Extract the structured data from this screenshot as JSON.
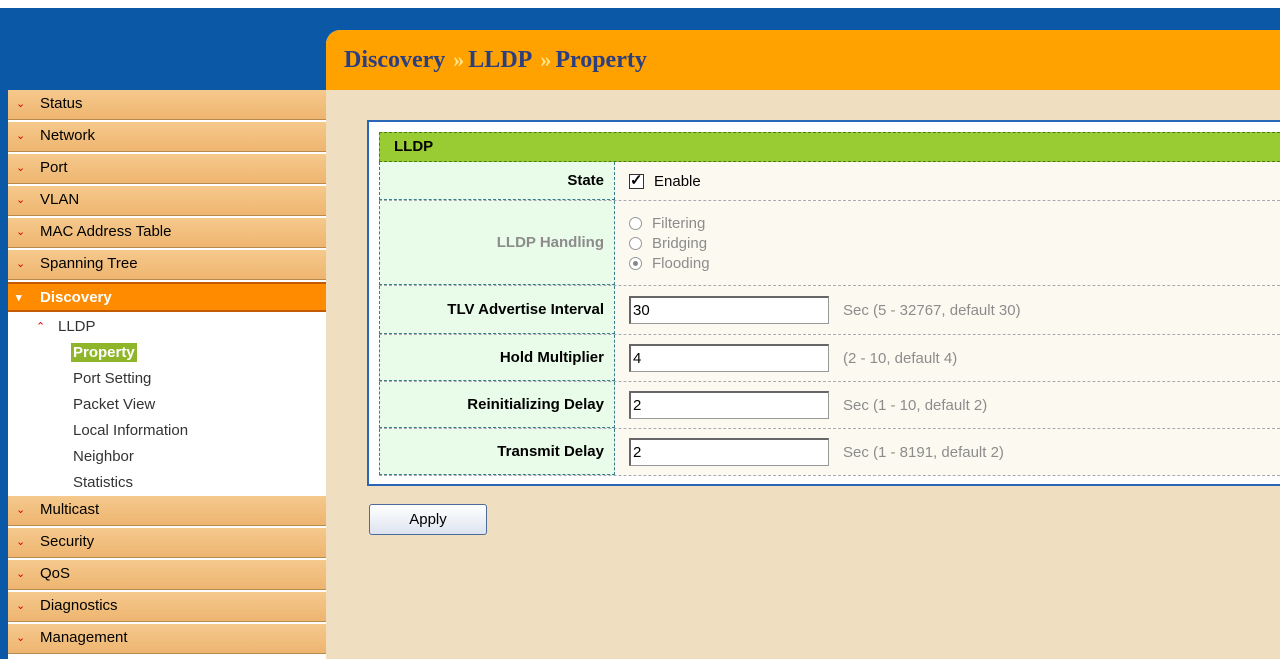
{
  "breadcrumb": [
    "Discovery",
    "LLDP",
    "Property"
  ],
  "breadcrumb_sep": "»",
  "sidebar": {
    "top_items": [
      "Status",
      "Network",
      "Port",
      "VLAN",
      "MAC Address Table",
      "Spanning Tree"
    ],
    "active_item": "Discovery",
    "sub_head": "LLDP",
    "leaves": [
      "Property",
      "Port Setting",
      "Packet View",
      "Local Information",
      "Neighbor",
      "Statistics"
    ],
    "bottom_items": [
      "Multicast",
      "Security",
      "QoS",
      "Diagnostics",
      "Management"
    ]
  },
  "panel": {
    "title": "LLDP",
    "state_label": "State",
    "state_value": "Enable",
    "handling_label": "LLDP Handling",
    "handling_options": [
      "Filtering",
      "Bridging",
      "Flooding"
    ],
    "handling_selected": "Flooding",
    "tlv_label": "TLV Advertise Interval",
    "tlv_value": "30",
    "tlv_hint": "Sec (5 - 32767, default 30)",
    "hold_label": "Hold Multiplier",
    "hold_value": "4",
    "hold_hint": "(2 - 10, default 4)",
    "reinit_label": "Reinitializing Delay",
    "reinit_value": "2",
    "reinit_hint": "Sec (1 - 10, default 2)",
    "tx_label": "Transmit Delay",
    "tx_value": "2",
    "tx_hint": "Sec (1 - 8191, default 2)"
  },
  "apply_label": "Apply"
}
